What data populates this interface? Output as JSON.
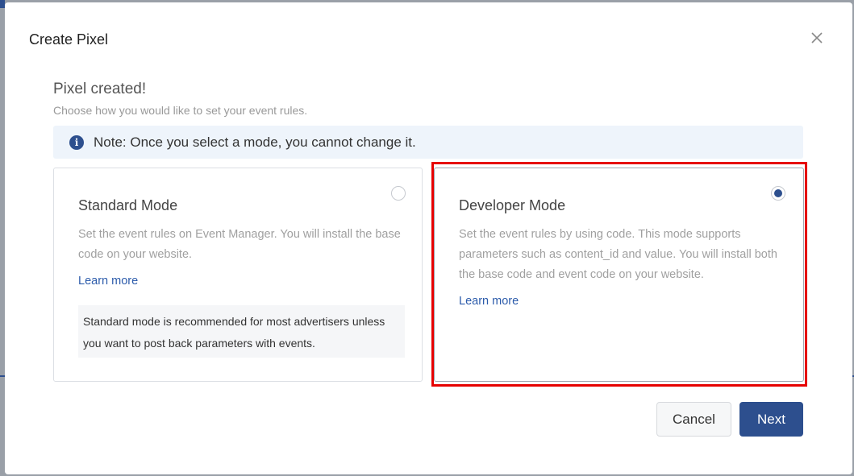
{
  "modal": {
    "title": "Create Pixel",
    "heading": "Pixel created!",
    "subheading": "Choose how you would like to set your event rules.",
    "note": "Note: Once you select a mode, you cannot change it."
  },
  "modes": {
    "standard": {
      "title": "Standard Mode",
      "description": "Set the event rules on Event Manager. You will install the base code on your website.",
      "learn_more": "Learn more",
      "recommendation": "Standard mode is recommended for most advertisers unless you want to post back parameters with events.",
      "selected": false
    },
    "developer": {
      "title": "Developer Mode",
      "description": "Set the event rules by using code. This mode supports parameters such as content_id and value. You will install both the base code and event code on your website.",
      "learn_more": "Learn more",
      "selected": true
    }
  },
  "buttons": {
    "cancel": "Cancel",
    "next": "Next"
  },
  "colors": {
    "primary": "#2d4f8e",
    "highlight": "#e60000",
    "link": "#2d5cab",
    "note_bg": "#eef4fb"
  },
  "icons": [
    "close-icon",
    "info-icon",
    "radio-icon"
  ]
}
